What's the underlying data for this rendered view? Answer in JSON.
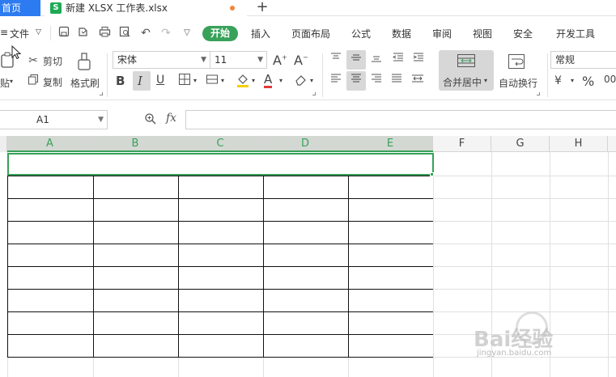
{
  "tabs": {
    "home": "首页",
    "document": "新建 XLSX 工作表.xlsx",
    "new_tab": "+"
  },
  "menu": {
    "file": "文件",
    "start": "开始",
    "items": [
      "插入",
      "页面布局",
      "公式",
      "数据",
      "审阅",
      "视图",
      "安全",
      "开发工具"
    ]
  },
  "ribbon": {
    "paste": "贴",
    "cut": "剪切",
    "copy": "复制",
    "format_painter": "格式刷",
    "font_name": "宋体",
    "font_size": "11",
    "merge_center": "合并居中",
    "wrap_text": "自动换行",
    "number_format": "常规",
    "percent": "%"
  },
  "formula": {
    "cell_ref": "A1",
    "fx": "fx",
    "value": ""
  },
  "sheet": {
    "columns": [
      "A",
      "B",
      "C",
      "D",
      "E",
      "F",
      "G",
      "H"
    ],
    "selected_columns": [
      "A",
      "B",
      "C",
      "D",
      "E"
    ],
    "selected_cell": "A1 (merged A1:E1)"
  },
  "watermark": {
    "brand": "Bai经验",
    "url": "jingyan.baidu.com"
  },
  "colors": {
    "accent_green": "#38a15a",
    "home_tab_blue": "#2d7bf0",
    "unsaved_dot": "#f0853c"
  }
}
